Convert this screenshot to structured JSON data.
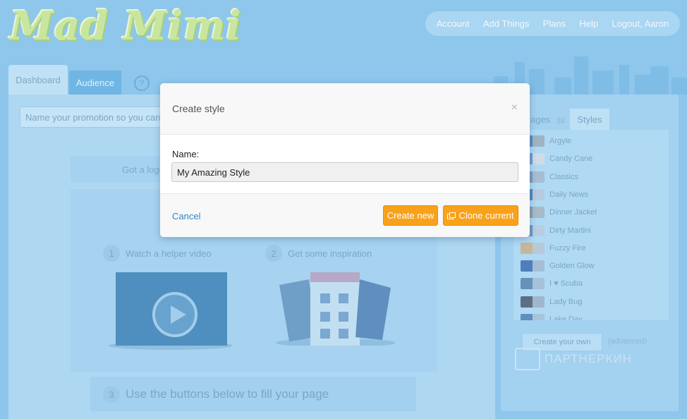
{
  "app": {
    "logo_text": "Mad Mimi"
  },
  "topnav": {
    "items": [
      "Account",
      "Add Things",
      "Plans",
      "Help",
      "Logout, Aaron"
    ]
  },
  "tabs": {
    "dashboard": "Dashboard",
    "audience": "Audience",
    "help": "?"
  },
  "editor": {
    "promo_placeholder": "Name your promotion so you can fi",
    "logo_prompt": "Got a logo",
    "step1_num": "1",
    "step1_label": "Watch a helper video",
    "step2_num": "2",
    "step2_label": "Get some inspiration",
    "step3_num": "3",
    "step3_label": "Use the buttons below to fill your page"
  },
  "right_panel": {
    "images_tab": "ages",
    "images_count": "33",
    "styles_tab": "Styles",
    "styles": [
      {
        "name": "Argyle",
        "colors": [
          "#5d8bb8",
          "#9fb3c3"
        ]
      },
      {
        "name": "Candy Cane",
        "colors": [
          "#6a9fd0",
          "#d0dbe6"
        ]
      },
      {
        "name": "Classics",
        "colors": [
          "#7b9ab8",
          "#a7bdd0"
        ]
      },
      {
        "name": "Daily News",
        "colors": [
          "#5288c0",
          "#b7cbe0"
        ]
      },
      {
        "name": "Dinner Jacket",
        "colors": [
          "#8a9cae",
          "#a8b9c9"
        ]
      },
      {
        "name": "Dirty Martini",
        "colors": [
          "#6a98c6",
          "#b9cde0"
        ]
      },
      {
        "name": "Fuzzy Fire",
        "colors": [
          "#c7b69a",
          "#b7c9d9"
        ]
      },
      {
        "name": "Golden Glow",
        "colors": [
          "#4f7fbb",
          "#a5bed6"
        ]
      },
      {
        "name": "I ♥ Scuba",
        "colors": [
          "#6593b8",
          "#a5c2d9"
        ]
      },
      {
        "name": "Lady Bug",
        "colors": [
          "#5b6f84",
          "#9fb7cd"
        ]
      },
      {
        "name": "Lake Day",
        "colors": [
          "#5f8fbe",
          "#a8c4dc"
        ]
      }
    ],
    "create_own": "Create your own",
    "advanced": "(advanced)"
  },
  "watermark": {
    "text": "ПАРТНЕРКИН"
  },
  "modal": {
    "title": "Create style",
    "close": "×",
    "name_label": "Name:",
    "name_value": "My Amazing Style",
    "cancel": "Cancel",
    "create_new": "Create new",
    "clone_current": "Clone current"
  }
}
